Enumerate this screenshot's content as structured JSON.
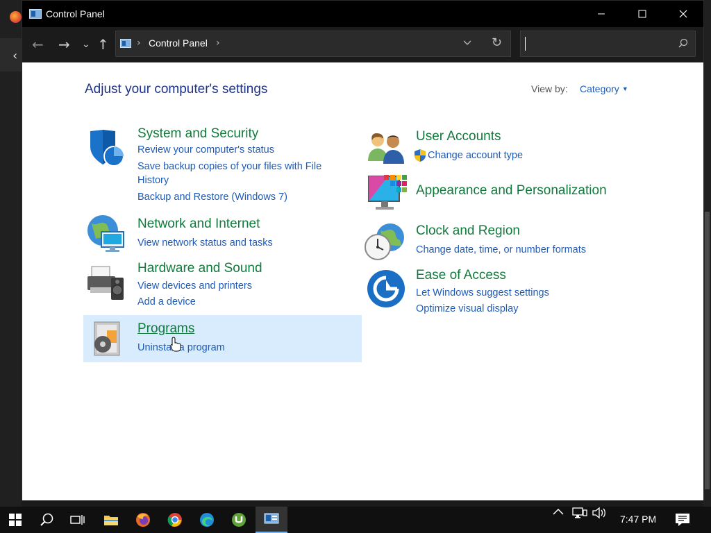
{
  "window": {
    "title": "Control Panel",
    "minimize": "—",
    "maximize": "☐",
    "close": "✕"
  },
  "nav": {
    "back": "←",
    "forward": "→",
    "recent": "⌄",
    "up": "↑",
    "breadcrumb": "Control Panel",
    "search_placeholder": ""
  },
  "main": {
    "heading": "Adjust your computer's settings",
    "view_by_label": "View by:",
    "view_by_value": "Category"
  },
  "categories_left": [
    {
      "title": "System and Security",
      "links": [
        "Review your computer's status",
        "Save backup copies of your files with File History",
        "Backup and Restore (Windows 7)"
      ]
    },
    {
      "title": "Network and Internet",
      "links": [
        "View network status and tasks"
      ]
    },
    {
      "title": "Hardware and Sound",
      "links": [
        "View devices and printers",
        "Add a device"
      ]
    },
    {
      "title": "Programs",
      "links": [
        "Uninstall a program"
      ]
    }
  ],
  "categories_right": [
    {
      "title": "User Accounts",
      "links": [
        "Change account type"
      ]
    },
    {
      "title": "Appearance and Personalization",
      "links": []
    },
    {
      "title": "Clock and Region",
      "links": [
        "Change date, time, or number formats"
      ]
    },
    {
      "title": "Ease of Access",
      "links": [
        "Let Windows suggest settings",
        "Optimize visual display"
      ]
    }
  ],
  "taskbar": {
    "time": "7:47 PM"
  },
  "colors": {
    "category_title": "#117a3c",
    "link": "#1f5cb8",
    "heading": "#1e3287",
    "hover_bg": "#d9ecfd"
  }
}
